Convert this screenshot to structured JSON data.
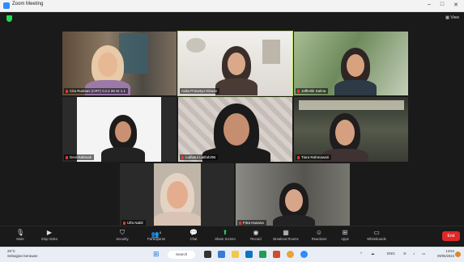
{
  "window": {
    "title": "Zoom Meeting",
    "controls": [
      "–",
      "□",
      "✕"
    ]
  },
  "header": {
    "view_label": "View"
  },
  "participants": [
    {
      "name": "Cita Rustiani (CRT) C4.2 26 SI 1.1"
    },
    {
      "name": "Aulia Prasetyo Nirwan"
    },
    {
      "name": "Jaffenlik Salma"
    },
    {
      "name": "Devi Rahmah"
    },
    {
      "name": "Lutfiatul Latifah/0B"
    },
    {
      "name": "Tiara Rahmawati"
    },
    {
      "name": "Ulfa Nabil"
    },
    {
      "name": "Fitra Husana"
    }
  ],
  "toolbar": {
    "items": [
      {
        "label": "Mute",
        "icon": "microphone-icon"
      },
      {
        "label": "Stop Video",
        "icon": "video-camera-icon"
      },
      {
        "label": "Security",
        "icon": "shield-icon"
      },
      {
        "label": "Participants",
        "icon": "participants-icon",
        "count": "8"
      },
      {
        "label": "Chat",
        "icon": "chat-icon"
      },
      {
        "label": "Share Screen",
        "icon": "share-screen-icon"
      },
      {
        "label": "Record",
        "icon": "record-icon"
      },
      {
        "label": "Breakout Rooms",
        "icon": "breakout-rooms-icon"
      },
      {
        "label": "Reactions",
        "icon": "reactions-icon"
      },
      {
        "label": "Apps",
        "icon": "apps-icon"
      },
      {
        "label": "Whiteboards",
        "icon": "whiteboard-icon"
      }
    ],
    "end_label": "End"
  },
  "taskbar": {
    "weather_temp": "26°C",
    "weather_desc": "Sebagian berawan",
    "search_label": "Search",
    "lang": "ENG",
    "time": "13:54",
    "date": "09/05/2023",
    "accent": "#2d8cff"
  }
}
